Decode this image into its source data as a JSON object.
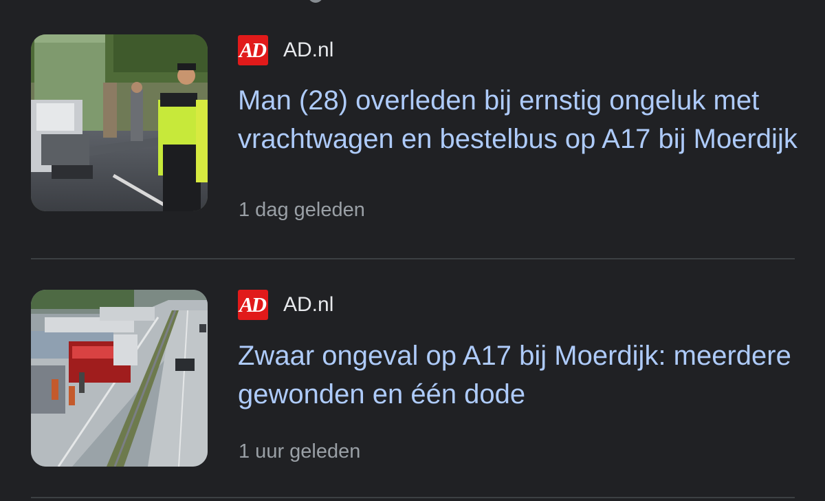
{
  "articles": [
    {
      "source": "AD.nl",
      "logo_text": "AD",
      "headline": "Man (28) overleden bij ernstig ongeluk met vrachtwagen en bestelbus op A17 bij Moerdijk",
      "time": "1 dag geleden",
      "thumbnail": "accident-scene-police-officer"
    },
    {
      "source": "AD.nl",
      "logo_text": "AD",
      "headline": "Zwaar ongeval op A17 bij Moerdijk: meerdere gewonden en één dode",
      "time": "1 uur geleden",
      "thumbnail": "highway-accident-aerial"
    }
  ],
  "colors": {
    "background": "#202124",
    "headline": "#aecbfa",
    "source": "#e8eaed",
    "time": "#9aa0a6",
    "logo": "#e11a1a",
    "divider": "#3c4043"
  }
}
